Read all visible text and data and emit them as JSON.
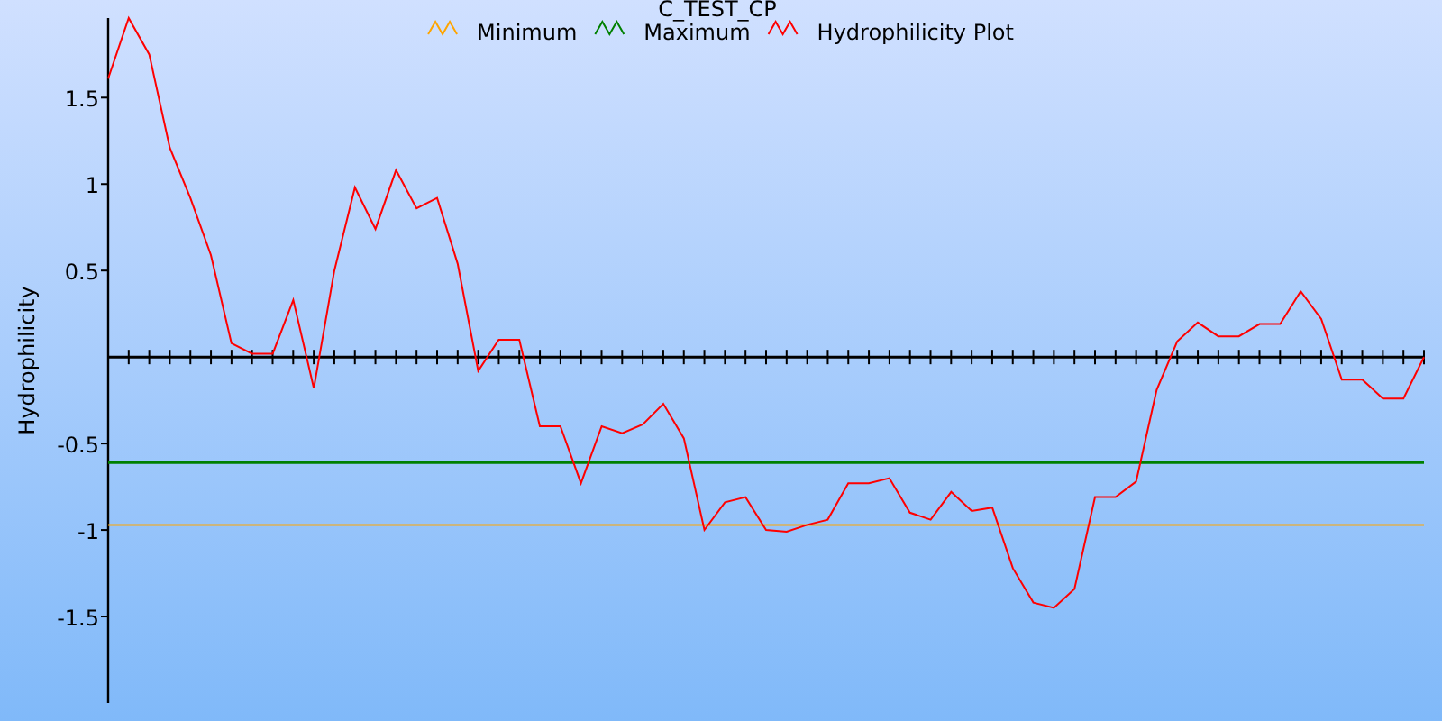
{
  "chart": {
    "chart_data": {
      "type": "line",
      "title": "C_TEST_CP",
      "ylabel": "Hydrophilicity",
      "categories": [
        null,
        null,
        null,
        null,
        null,
        null,
        null,
        null,
        null,
        null,
        null,
        null,
        null,
        null,
        null,
        null,
        null,
        null,
        null,
        null,
        null,
        null,
        null,
        null,
        null,
        null,
        null,
        null,
        null,
        null,
        null,
        null,
        null,
        null,
        null,
        null,
        null,
        null,
        null,
        null,
        null,
        null,
        null,
        null,
        null,
        null,
        null,
        null,
        null,
        null,
        null,
        null,
        null,
        null,
        null,
        null,
        null,
        null,
        null,
        null,
        null,
        null,
        null,
        null,
        null
      ],
      "series": [
        {
          "name": "Minimum",
          "color": "#ffa500",
          "values": [
            -0.97,
            -0.97,
            -0.97,
            -0.97,
            -0.97,
            -0.97,
            -0.97,
            -0.97,
            -0.97,
            -0.97,
            -0.97,
            -0.97,
            -0.97,
            -0.97,
            -0.97,
            -0.97,
            -0.97,
            -0.97,
            -0.97,
            -0.97,
            -0.97,
            -0.97,
            -0.97,
            -0.97,
            -0.97,
            -0.97,
            -0.97,
            -0.97,
            -0.97,
            -0.97,
            -0.97,
            -0.97,
            -0.97,
            -0.97,
            -0.97,
            -0.97,
            -0.97,
            -0.97,
            -0.97,
            -0.97,
            -0.97,
            -0.97,
            -0.97,
            -0.97,
            -0.97,
            -0.97,
            -0.97,
            -0.97,
            -0.97,
            -0.97,
            -0.97,
            -0.97,
            -0.97,
            -0.97,
            -0.97,
            -0.97,
            -0.97,
            -0.97,
            -0.97,
            -0.97,
            -0.97,
            -0.97,
            -0.97,
            -0.97,
            -0.97
          ]
        },
        {
          "name": "Maximum",
          "color": "#008000",
          "values": [
            -0.61,
            -0.61,
            -0.61,
            -0.61,
            -0.61,
            -0.61,
            -0.61,
            -0.61,
            -0.61,
            -0.61,
            -0.61,
            -0.61,
            -0.61,
            -0.61,
            -0.61,
            -0.61,
            -0.61,
            -0.61,
            -0.61,
            -0.61,
            -0.61,
            -0.61,
            -0.61,
            -0.61,
            -0.61,
            -0.61,
            -0.61,
            -0.61,
            -0.61,
            -0.61,
            -0.61,
            -0.61,
            -0.61,
            -0.61,
            -0.61,
            -0.61,
            -0.61,
            -0.61,
            -0.61,
            -0.61,
            -0.61,
            -0.61,
            -0.61,
            -0.61,
            -0.61,
            -0.61,
            -0.61,
            -0.61,
            -0.61,
            -0.61,
            -0.61,
            -0.61,
            -0.61,
            -0.61,
            -0.61,
            -0.61,
            -0.61,
            -0.61,
            -0.61,
            -0.61,
            -0.61,
            -0.61,
            -0.61,
            -0.61,
            -0.61
          ]
        },
        {
          "name": "Hydrophilicity Plot",
          "color": "#ff0000",
          "values": [
            1.61,
            1.96,
            1.75,
            1.21,
            0.92,
            0.59,
            0.08,
            0.02,
            0.02,
            0.33,
            -0.18,
            0.5,
            0.98,
            0.74,
            1.08,
            0.86,
            0.92,
            0.54,
            -0.08,
            0.1,
            0.1,
            -0.4,
            -0.4,
            -0.73,
            -0.4,
            -0.44,
            -0.39,
            -0.27,
            -0.47,
            -1.0,
            -0.84,
            -0.81,
            -1.0,
            -1.01,
            -0.97,
            -0.94,
            -0.73,
            -0.73,
            -0.7,
            -0.9,
            -0.94,
            -0.78,
            -0.89,
            -0.87,
            -1.22,
            -1.42,
            -1.45,
            -1.34,
            -0.81,
            -0.81,
            -0.72,
            -0.19,
            0.09,
            0.2,
            0.12,
            0.12,
            0.19,
            0.19,
            0.38,
            0.22,
            -0.13,
            -0.13,
            -0.24,
            -0.24,
            0.0
          ]
        }
      ],
      "ylim": [
        -2.0,
        1.96
      ],
      "legend": "top",
      "yticks": [
        {
          "value": -1.5,
          "label": "-1.5"
        },
        {
          "value": -1,
          "label": "-1"
        },
        {
          "value": -0.5,
          "label": "-0.5"
        },
        {
          "value": 0.5,
          "label": "0.5"
        },
        {
          "value": 1,
          "label": "1"
        },
        {
          "value": 1.5,
          "label": "1.5"
        }
      ]
    }
  }
}
